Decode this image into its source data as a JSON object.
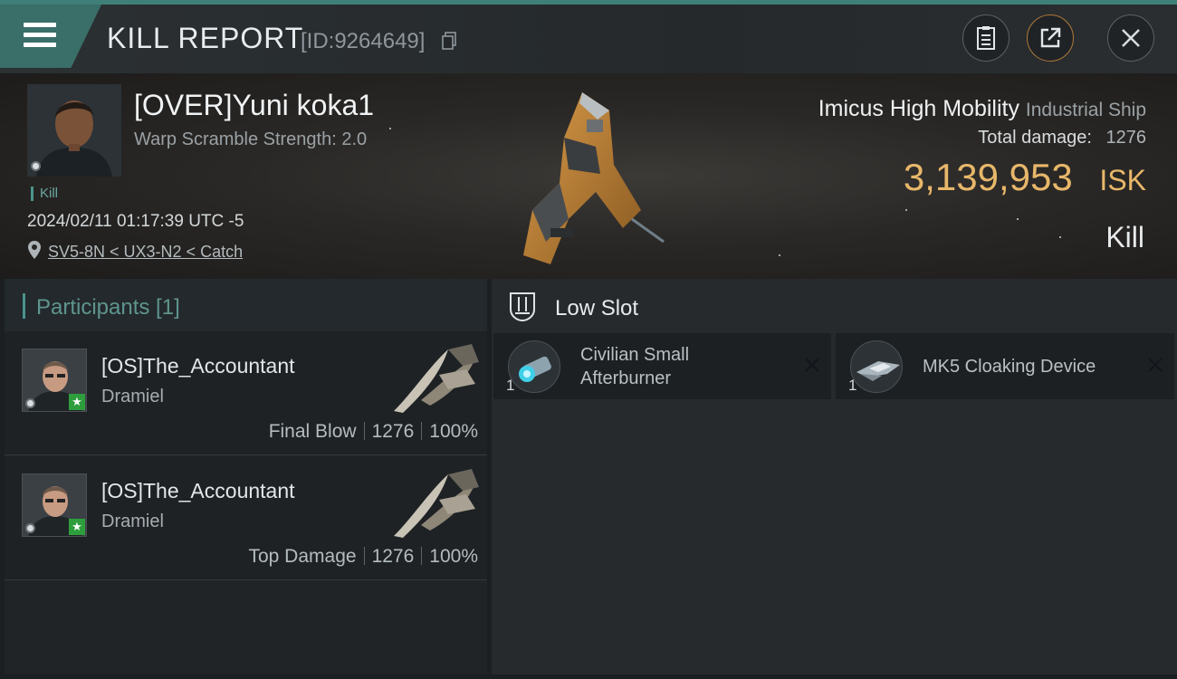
{
  "header": {
    "title": "KILL REPORT",
    "report_id": "[ID:9264649]",
    "accent": "#3f7f79"
  },
  "victim": {
    "pilot_name": "[OVER]Yuni koka1",
    "scramble": "Warp Scramble Strength: 2.0",
    "tag": "Kill",
    "datetime": "2024/02/11 01:17:39 UTC -5",
    "location": "SV5-8N < UX3-N2 < Catch"
  },
  "ship": {
    "name": "Imicus High Mobility",
    "class": "Industrial Ship",
    "total_damage_label": "Total damage:",
    "total_damage_value": "1276",
    "isk_value": "3,139,953",
    "isk_unit": "ISK",
    "result": "Kill",
    "isk_color": "#e8b76a"
  },
  "participants": {
    "label": "Participants [1]",
    "items": [
      {
        "name": "[OS]The_Accountant",
        "ship": "Dramiel",
        "role": "Final Blow",
        "damage": "1276",
        "percent": "100%"
      },
      {
        "name": "[OS]The_Accountant",
        "ship": "Dramiel",
        "role": "Top Damage",
        "damage": "1276",
        "percent": "100%"
      }
    ]
  },
  "fitting": {
    "slot_label": "Low Slot",
    "modules": [
      {
        "name_line1": "Civilian Small",
        "name_line2": "Afterburner",
        "qty": "1",
        "icon": "afterburner-icon"
      },
      {
        "name_line1": "MK5 Cloaking Device",
        "name_line2": "",
        "qty": "1",
        "icon": "cloaking-device-icon"
      }
    ]
  }
}
